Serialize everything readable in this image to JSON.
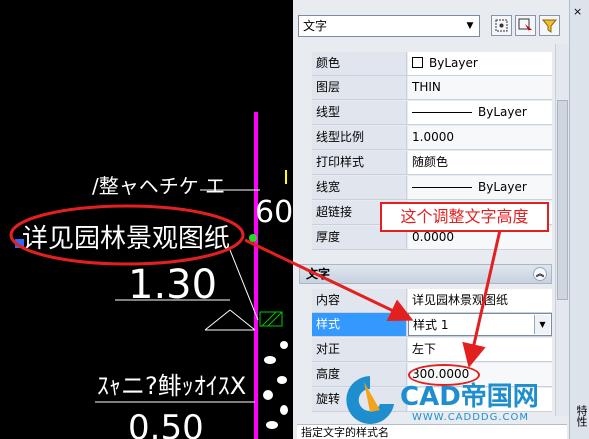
{
  "canvas": {
    "texts": {
      "top_partial": "/整ャヘチケ エ",
      "main_label": "详见园林景观图纸",
      "dim_value": "1.30",
      "bottom_partial": "ｽｬニ?鲱ｯｵｲｽX",
      "bottom_value": "0.50",
      "side_digits": "60"
    }
  },
  "palette": {
    "type_select": "文字",
    "rows_general": [
      {
        "label": "颜色",
        "value": "ByLayer",
        "swatch": "color"
      },
      {
        "label": "图层",
        "value": "THIN"
      },
      {
        "label": "线型",
        "value": "ByLayer",
        "swatch": "line"
      },
      {
        "label": "线型比例",
        "value": "1.0000"
      },
      {
        "label": "打印样式",
        "value": "随颜色"
      },
      {
        "label": "线宽",
        "value": "ByLayer",
        "swatch": "line"
      },
      {
        "label": "超链接",
        "value": ""
      },
      {
        "label": "厚度",
        "value": "0.0000"
      }
    ],
    "section_title": "文字",
    "rows_text": [
      {
        "label": "内容",
        "value": "详见园林景观图纸"
      },
      {
        "label": "样式",
        "value": "样式 1"
      },
      {
        "label": "对正",
        "value": "左下"
      },
      {
        "label": "高度",
        "value": "300.0000"
      },
      {
        "label": "旋转",
        "value": ""
      }
    ],
    "status_hint": "指定文字的样式名",
    "side_tab": "特性",
    "close": "×"
  },
  "annotation": {
    "callout_text": "这个调整文字高度",
    "color": "#e32020"
  },
  "watermark": {
    "brand": "CAD帝国网",
    "url": "WWW.CADDDG.COM"
  }
}
